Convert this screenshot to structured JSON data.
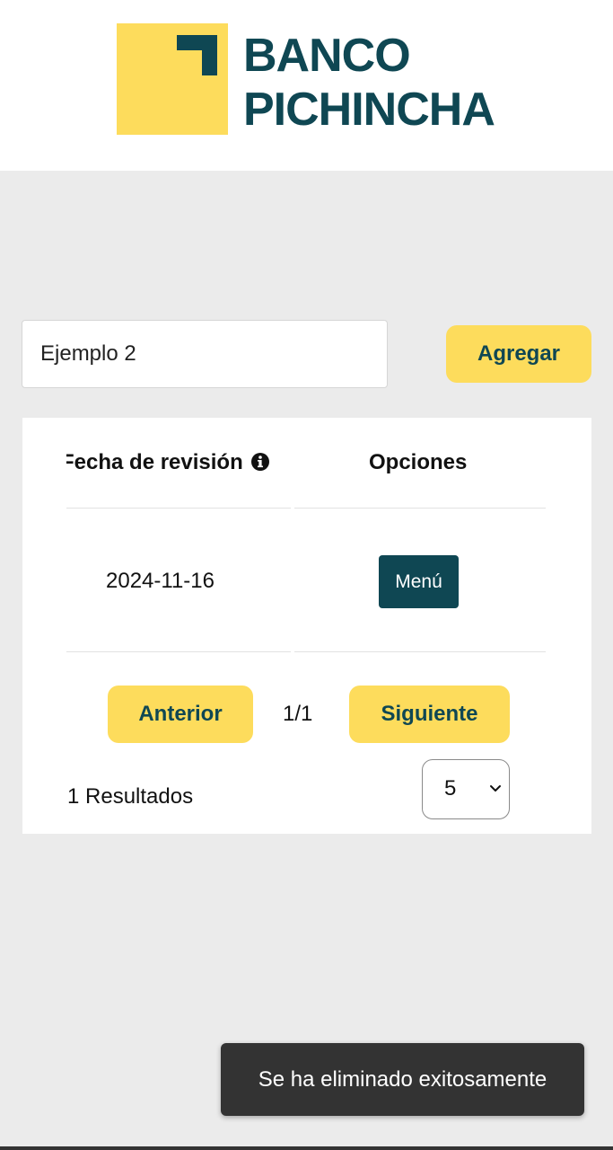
{
  "brand": {
    "line1": "BANCO",
    "line2": "PICHINCHA",
    "colors": {
      "yellow": "#fddc5c",
      "teal": "#0f4753"
    },
    "logo_icon": "pichincha-corner-logo-icon"
  },
  "search": {
    "value": "Ejemplo 2",
    "add_label": "Agregar"
  },
  "table": {
    "columns": [
      {
        "label": "Fecha de revisión",
        "icon": "info-circle-icon"
      },
      {
        "label": "Opciones"
      }
    ],
    "rows": [
      {
        "fecha": "2024-11-16",
        "action_label": "Menú"
      }
    ]
  },
  "pagination": {
    "prev_label": "Anterior",
    "next_label": "Siguiente",
    "page_indicator": "1/1",
    "results_text": "1 Resultados",
    "page_size": "5"
  },
  "toast": {
    "message": "Se ha eliminado exitosamente"
  }
}
